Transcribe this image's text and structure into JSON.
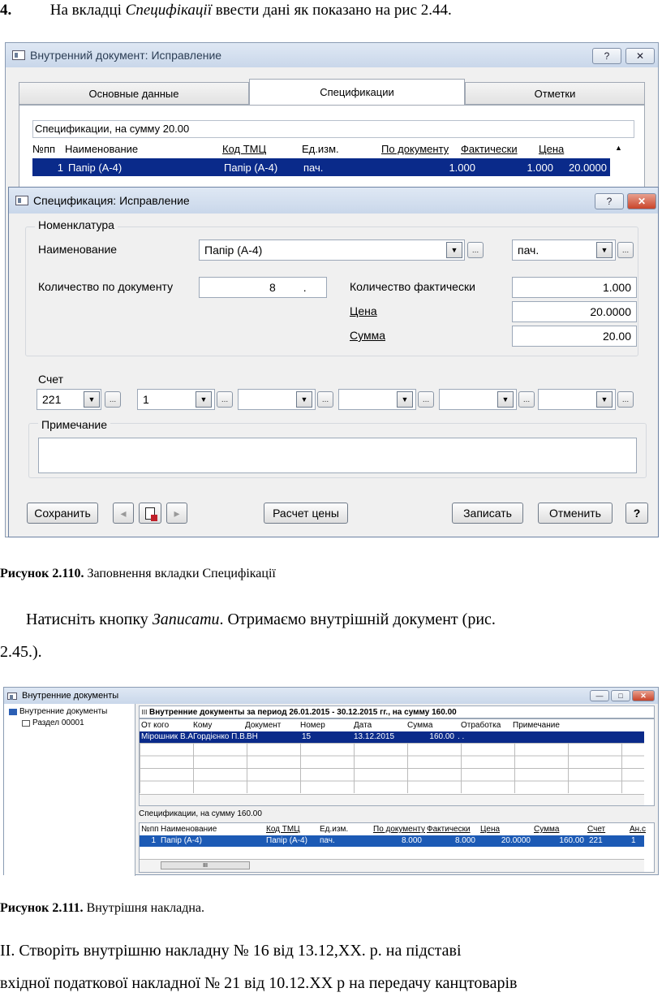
{
  "intro": {
    "number": "4.",
    "text_before": "На вкладці ",
    "text_italic": "Специфікації",
    "text_after": " ввести дані як показано на рис 2.44."
  },
  "fig1": {
    "outer_title": "Внутренний документ: Исправление",
    "outer_help": "?",
    "outer_close": "✕",
    "tabs": [
      "Основные данные",
      "Спецификации",
      "Отметки"
    ],
    "spec_header": "Спецификации, на сумму 20.00",
    "grid_columns": [
      "№пп",
      "Наименование",
      "Код ТМЦ",
      "Ед.изм.",
      "По документу",
      "Фактически",
      "Цена"
    ],
    "grid_row": [
      "1",
      "Папір (А-4)",
      "Папір (А-4)",
      "пач.",
      "1.000",
      "1.000",
      "20.0000"
    ],
    "dialog_title": "Спецификация: Исправление",
    "dialog_help": "?",
    "dialog_close": "✕",
    "group_nomenclature": "Номенклатура",
    "label_name": "Наименование",
    "name_value": "Папір (А-4)",
    "unit_value": "пач.",
    "label_qty_doc": "Количество по документу",
    "qty_doc_value": "8",
    "qty_doc_dot": ".",
    "label_qty_fact": "Количество фактически",
    "qty_fact_value": "1.000",
    "label_price": "Цена",
    "price_value": "20.0000",
    "label_sum": "Сумма",
    "sum_value": "20.00",
    "label_account": "Счет",
    "account_values": [
      "221",
      "1",
      "",
      "",
      "",
      ""
    ],
    "label_note": "Примечание",
    "btn_save": "Сохранить",
    "btn_calc": "Расчет цены",
    "btn_write": "Записать",
    "btn_cancel": "Отменить",
    "btn_help": "?",
    "ellipsis": "...",
    "arrow_down": "▼",
    "arrow_left": "◂",
    "arrow_right": "▸",
    "scroll_up": "▲"
  },
  "caption1": {
    "bold": "Рисунок 2.110.",
    "text": " Заповнення вкладки Специфікації"
  },
  "para2": {
    "line1_a": "Натисніть кнопку ",
    "line1_italic": "Записати",
    "line1_b": ". Отримаємо внутрішній документ (рис.",
    "line2": "2.45.)."
  },
  "fig2": {
    "title": "Внутренние документы",
    "tree_root": "Внутренние документы",
    "tree_child": "Раздел 00001",
    "header": "Внутренние документы за период 26.01.2015 - 30.12.2015 гг., на сумму 160.00",
    "columns": [
      "От кого",
      "Кому",
      "Документ",
      "Номер",
      "Дата",
      "Сумма",
      "Отработка",
      "Примечание"
    ],
    "row": [
      "Мірошник В.А.",
      "Гордієнко П.В.",
      "ВН",
      "15",
      "13.12.2015",
      "160.00",
      ". .",
      ""
    ],
    "spec_header": "Спецификации, на сумму 160.00",
    "spec_columns": [
      "№пп",
      "Наименование",
      "Код ТМЦ",
      "Ед.изм.",
      "По документу",
      "Фактически",
      "Цена",
      "Сумма",
      "Счет",
      "Ан.с"
    ],
    "spec_row": [
      "1",
      "Папір (А-4)",
      "Папір (А-4)",
      "пач.",
      "8.000",
      "8.000",
      "20.0000",
      "160.00",
      "221",
      "1"
    ],
    "scroll_thumb": "III"
  },
  "caption2": {
    "bold": "Рисунок 2.111.",
    "text": " Внутрішня накладна."
  },
  "para3": {
    "line1": "ІІ. Створіть внутрішню накладну № 16 від 13.12,ХХ. р. на підставі",
    "line2": "вхідної податкової накладної № 21 від 10.12.ХХ р на передачу канцтоварів"
  }
}
